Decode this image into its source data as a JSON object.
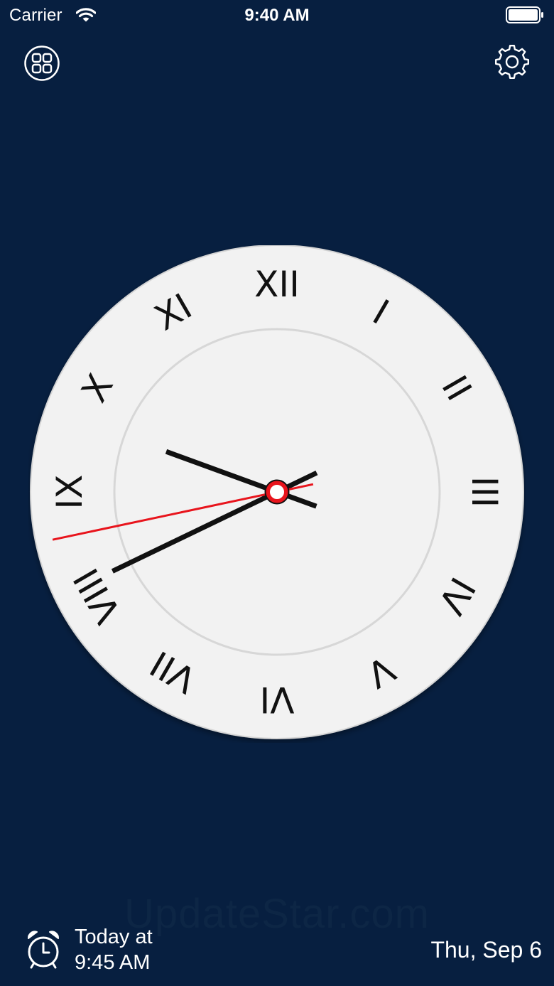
{
  "status_bar": {
    "carrier": "Carrier",
    "time": "9:40 AM",
    "wifi_icon": "wifi-icon",
    "battery_icon": "battery-icon"
  },
  "toolbar": {
    "apps_icon": "grid-apps-icon",
    "settings_icon": "gear-icon"
  },
  "clock": {
    "numerals": [
      "XII",
      "I",
      "II",
      "III",
      "IV",
      "V",
      "VI",
      "VII",
      "VIII",
      "IX",
      "X",
      "XI"
    ],
    "hour": 9,
    "minute": 40,
    "second": 43,
    "colors": {
      "face": "#f2f2f2",
      "hands": "#111111",
      "second_hand": "#e8141c"
    }
  },
  "watermark": "UpdateStar.com",
  "alarm": {
    "icon": "alarm-clock-icon",
    "line1": "Today at",
    "line2": "9:45 AM"
  },
  "date": "Thu, Sep 6",
  "colors": {
    "background": "#071f40",
    "text": "#ffffff"
  }
}
